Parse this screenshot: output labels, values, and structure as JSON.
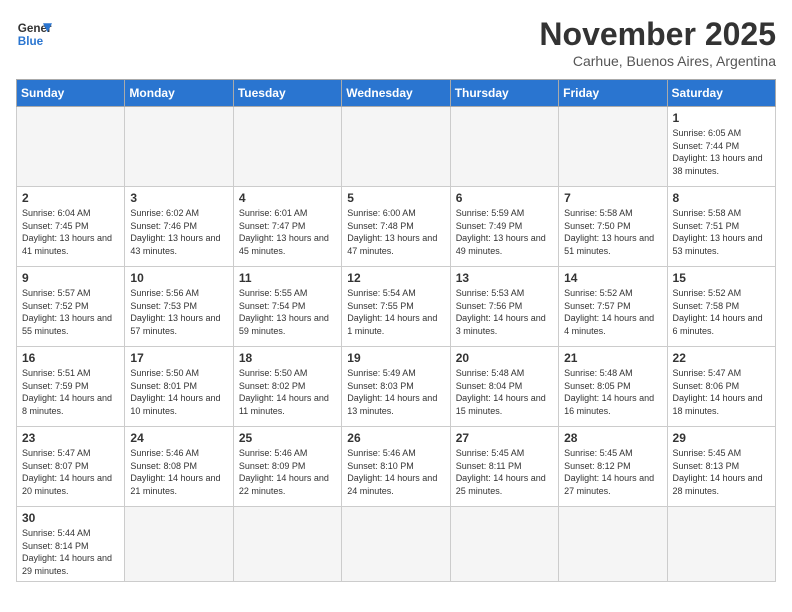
{
  "header": {
    "logo_general": "General",
    "logo_blue": "Blue",
    "month_title": "November 2025",
    "subtitle": "Carhue, Buenos Aires, Argentina"
  },
  "weekdays": [
    "Sunday",
    "Monday",
    "Tuesday",
    "Wednesday",
    "Thursday",
    "Friday",
    "Saturday"
  ],
  "days": [
    {
      "num": "",
      "sunrise": "",
      "sunset": "",
      "daylight": "",
      "empty": true
    },
    {
      "num": "",
      "sunrise": "",
      "sunset": "",
      "daylight": "",
      "empty": true
    },
    {
      "num": "",
      "sunrise": "",
      "sunset": "",
      "daylight": "",
      "empty": true
    },
    {
      "num": "",
      "sunrise": "",
      "sunset": "",
      "daylight": "",
      "empty": true
    },
    {
      "num": "",
      "sunrise": "",
      "sunset": "",
      "daylight": "",
      "empty": true
    },
    {
      "num": "",
      "sunrise": "",
      "sunset": "",
      "daylight": "",
      "empty": true
    },
    {
      "num": "1",
      "sunrise": "Sunrise: 6:05 AM",
      "sunset": "Sunset: 7:44 PM",
      "daylight": "Daylight: 13 hours and 38 minutes."
    },
    {
      "num": "2",
      "sunrise": "Sunrise: 6:04 AM",
      "sunset": "Sunset: 7:45 PM",
      "daylight": "Daylight: 13 hours and 41 minutes."
    },
    {
      "num": "3",
      "sunrise": "Sunrise: 6:02 AM",
      "sunset": "Sunset: 7:46 PM",
      "daylight": "Daylight: 13 hours and 43 minutes."
    },
    {
      "num": "4",
      "sunrise": "Sunrise: 6:01 AM",
      "sunset": "Sunset: 7:47 PM",
      "daylight": "Daylight: 13 hours and 45 minutes."
    },
    {
      "num": "5",
      "sunrise": "Sunrise: 6:00 AM",
      "sunset": "Sunset: 7:48 PM",
      "daylight": "Daylight: 13 hours and 47 minutes."
    },
    {
      "num": "6",
      "sunrise": "Sunrise: 5:59 AM",
      "sunset": "Sunset: 7:49 PM",
      "daylight": "Daylight: 13 hours and 49 minutes."
    },
    {
      "num": "7",
      "sunrise": "Sunrise: 5:58 AM",
      "sunset": "Sunset: 7:50 PM",
      "daylight": "Daylight: 13 hours and 51 minutes."
    },
    {
      "num": "8",
      "sunrise": "Sunrise: 5:58 AM",
      "sunset": "Sunset: 7:51 PM",
      "daylight": "Daylight: 13 hours and 53 minutes."
    },
    {
      "num": "9",
      "sunrise": "Sunrise: 5:57 AM",
      "sunset": "Sunset: 7:52 PM",
      "daylight": "Daylight: 13 hours and 55 minutes."
    },
    {
      "num": "10",
      "sunrise": "Sunrise: 5:56 AM",
      "sunset": "Sunset: 7:53 PM",
      "daylight": "Daylight: 13 hours and 57 minutes."
    },
    {
      "num": "11",
      "sunrise": "Sunrise: 5:55 AM",
      "sunset": "Sunset: 7:54 PM",
      "daylight": "Daylight: 13 hours and 59 minutes."
    },
    {
      "num": "12",
      "sunrise": "Sunrise: 5:54 AM",
      "sunset": "Sunset: 7:55 PM",
      "daylight": "Daylight: 14 hours and 1 minute."
    },
    {
      "num": "13",
      "sunrise": "Sunrise: 5:53 AM",
      "sunset": "Sunset: 7:56 PM",
      "daylight": "Daylight: 14 hours and 3 minutes."
    },
    {
      "num": "14",
      "sunrise": "Sunrise: 5:52 AM",
      "sunset": "Sunset: 7:57 PM",
      "daylight": "Daylight: 14 hours and 4 minutes."
    },
    {
      "num": "15",
      "sunrise": "Sunrise: 5:52 AM",
      "sunset": "Sunset: 7:58 PM",
      "daylight": "Daylight: 14 hours and 6 minutes."
    },
    {
      "num": "16",
      "sunrise": "Sunrise: 5:51 AM",
      "sunset": "Sunset: 7:59 PM",
      "daylight": "Daylight: 14 hours and 8 minutes."
    },
    {
      "num": "17",
      "sunrise": "Sunrise: 5:50 AM",
      "sunset": "Sunset: 8:01 PM",
      "daylight": "Daylight: 14 hours and 10 minutes."
    },
    {
      "num": "18",
      "sunrise": "Sunrise: 5:50 AM",
      "sunset": "Sunset: 8:02 PM",
      "daylight": "Daylight: 14 hours and 11 minutes."
    },
    {
      "num": "19",
      "sunrise": "Sunrise: 5:49 AM",
      "sunset": "Sunset: 8:03 PM",
      "daylight": "Daylight: 14 hours and 13 minutes."
    },
    {
      "num": "20",
      "sunrise": "Sunrise: 5:48 AM",
      "sunset": "Sunset: 8:04 PM",
      "daylight": "Daylight: 14 hours and 15 minutes."
    },
    {
      "num": "21",
      "sunrise": "Sunrise: 5:48 AM",
      "sunset": "Sunset: 8:05 PM",
      "daylight": "Daylight: 14 hours and 16 minutes."
    },
    {
      "num": "22",
      "sunrise": "Sunrise: 5:47 AM",
      "sunset": "Sunset: 8:06 PM",
      "daylight": "Daylight: 14 hours and 18 minutes."
    },
    {
      "num": "23",
      "sunrise": "Sunrise: 5:47 AM",
      "sunset": "Sunset: 8:07 PM",
      "daylight": "Daylight: 14 hours and 20 minutes."
    },
    {
      "num": "24",
      "sunrise": "Sunrise: 5:46 AM",
      "sunset": "Sunset: 8:08 PM",
      "daylight": "Daylight: 14 hours and 21 minutes."
    },
    {
      "num": "25",
      "sunrise": "Sunrise: 5:46 AM",
      "sunset": "Sunset: 8:09 PM",
      "daylight": "Daylight: 14 hours and 22 minutes."
    },
    {
      "num": "26",
      "sunrise": "Sunrise: 5:46 AM",
      "sunset": "Sunset: 8:10 PM",
      "daylight": "Daylight: 14 hours and 24 minutes."
    },
    {
      "num": "27",
      "sunrise": "Sunrise: 5:45 AM",
      "sunset": "Sunset: 8:11 PM",
      "daylight": "Daylight: 14 hours and 25 minutes."
    },
    {
      "num": "28",
      "sunrise": "Sunrise: 5:45 AM",
      "sunset": "Sunset: 8:12 PM",
      "daylight": "Daylight: 14 hours and 27 minutes."
    },
    {
      "num": "29",
      "sunrise": "Sunrise: 5:45 AM",
      "sunset": "Sunset: 8:13 PM",
      "daylight": "Daylight: 14 hours and 28 minutes."
    },
    {
      "num": "30",
      "sunrise": "Sunrise: 5:44 AM",
      "sunset": "Sunset: 8:14 PM",
      "daylight": "Daylight: 14 hours and 29 minutes."
    },
    {
      "num": "",
      "sunrise": "",
      "sunset": "",
      "daylight": "",
      "empty": true
    },
    {
      "num": "",
      "sunrise": "",
      "sunset": "",
      "daylight": "",
      "empty": true
    },
    {
      "num": "",
      "sunrise": "",
      "sunset": "",
      "daylight": "",
      "empty": true
    },
    {
      "num": "",
      "sunrise": "",
      "sunset": "",
      "daylight": "",
      "empty": true
    },
    {
      "num": "",
      "sunrise": "",
      "sunset": "",
      "daylight": "",
      "empty": true
    },
    {
      "num": "",
      "sunrise": "",
      "sunset": "",
      "daylight": "",
      "empty": true
    }
  ]
}
